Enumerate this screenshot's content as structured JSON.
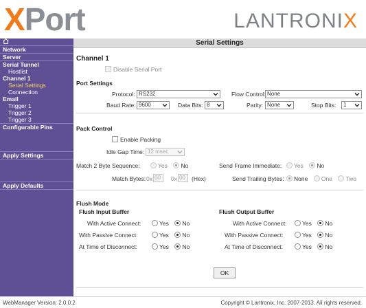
{
  "header": {
    "logo_x": "X",
    "logo_port": "Port",
    "brand_lant": "LANTRONI",
    "brand_x": "X"
  },
  "sidebar": {
    "items": [
      {
        "label": "Network"
      },
      {
        "label": "Server"
      },
      {
        "label": "Serial Tunnel"
      },
      {
        "label": "Hostlist"
      },
      {
        "label": "Channel 1"
      },
      {
        "label": "Serial Settings"
      },
      {
        "label": "Connection"
      },
      {
        "label": "Email"
      },
      {
        "label": "Trigger 1"
      },
      {
        "label": "Trigger 2"
      },
      {
        "label": "Trigger 3"
      },
      {
        "label": "Configurable Pins"
      }
    ],
    "apply_settings": "Apply Settings",
    "apply_defaults": "Apply Defaults"
  },
  "page": {
    "title": "Serial Settings",
    "channel_heading": "Channel 1",
    "disable_serial_port": "Disable Serial Port",
    "port_settings": {
      "heading": "Port Settings",
      "protocol_label": "Protocol:",
      "protocol_value": "RS232",
      "flow_control_label": "Flow Control:",
      "flow_control_value": "None",
      "baud_rate_label": "Baud Rate:",
      "baud_rate_value": "9600",
      "data_bits_label": "Data Bits:",
      "data_bits_value": "8",
      "parity_label": "Parity:",
      "parity_value": "None",
      "stop_bits_label": "Stop Bits:",
      "stop_bits_value": "1"
    },
    "pack_control": {
      "heading": "Pack Control",
      "enable_packing": "Enable Packing",
      "idle_gap_label": "Idle Gap Time:",
      "idle_gap_value": "12 msec",
      "match2_label": "Match 2 Byte Sequence:",
      "send_frame_label": "Send Frame Immediate:",
      "match_bytes_label": "Match Bytes:",
      "match_prefix": "0x",
      "match_byte1": "00",
      "match_byte2": "00",
      "hex_label": "(Hex)",
      "send_trailing_label": "Send Trailing Bytes:",
      "yes": "Yes",
      "no": "No",
      "none": "None",
      "one": "One",
      "two": "Two"
    },
    "flush_mode": {
      "heading": "Flush Mode",
      "input_heading": "Flush Input Buffer",
      "output_heading": "Flush Output Buffer",
      "with_active": "With Active Connect:",
      "with_passive": "With Passive Connect:",
      "at_disconnect": "At Time of Disconnect:",
      "yes": "Yes",
      "no": "No"
    },
    "ok_button": "OK"
  },
  "footer": {
    "version": "WebManager Version: 2.0.0.2",
    "copyright": "Copyright © Lantronix, Inc. 2007-2013. All rights reserved."
  },
  "colors": {
    "sidebar_bg": "#5f4f95",
    "brand_orange": "#f07b1d",
    "active_item": "#f7d45a"
  }
}
